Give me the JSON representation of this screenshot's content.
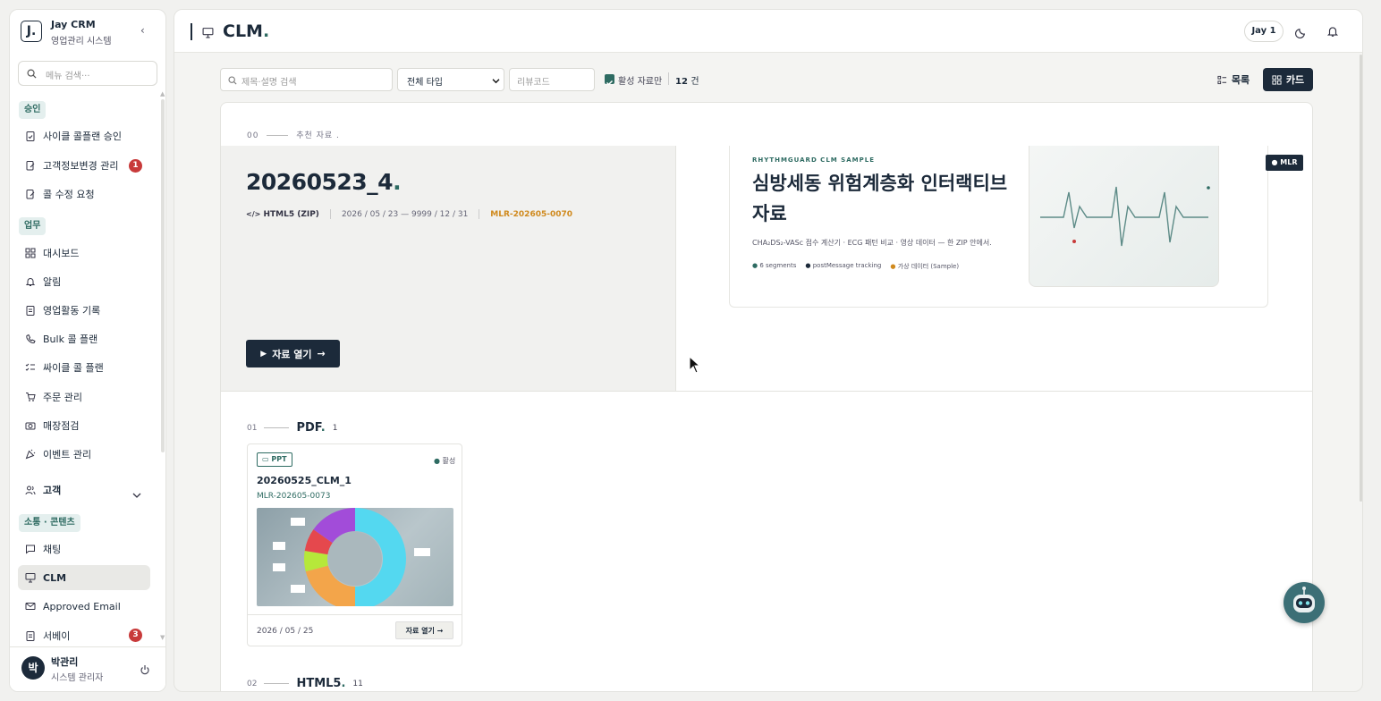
{
  "app": {
    "name": "Jay CRM",
    "subtitle": "영업관리 시스템",
    "logo_glyph": "J.",
    "collapse_glyph": "‹"
  },
  "sidebar": {
    "search_placeholder": "메뉴 검색···",
    "sections": [
      {
        "label": "승인",
        "items": [
          {
            "label": "사이클 콜플랜 승인",
            "icon": "clipboard-check-icon"
          },
          {
            "label": "고객정보변경 관리",
            "icon": "edit-doc-icon",
            "badge": "1"
          },
          {
            "label": "콜 수정 요청",
            "icon": "edit-doc-icon"
          }
        ]
      },
      {
        "label": "업무",
        "items": [
          {
            "label": "대시보드",
            "icon": "grid-icon"
          },
          {
            "label": "알림",
            "icon": "bell-icon"
          },
          {
            "label": "영업활동 기록",
            "icon": "clipboard-icon"
          },
          {
            "label": "Bulk 콜 플랜",
            "icon": "phone-icon"
          },
          {
            "label": "싸이클 콜 플랜",
            "icon": "list-check-icon"
          },
          {
            "label": "주문 관리",
            "icon": "cart-icon"
          },
          {
            "label": "매장점검",
            "icon": "camera-icon"
          },
          {
            "label": "이벤트 관리",
            "icon": "party-icon"
          }
        ]
      },
      {
        "label": "고객",
        "collapsible": true
      },
      {
        "label": "소통 · 콘텐츠",
        "items": [
          {
            "label": "채팅",
            "icon": "chat-icon"
          },
          {
            "label": "CLM",
            "icon": "presentation-icon",
            "active": true
          },
          {
            "label": "Approved Email",
            "icon": "mail-icon"
          },
          {
            "label": "서베이",
            "icon": "clipboard-icon",
            "badge": "3"
          }
        ]
      }
    ],
    "user": {
      "initial": "박",
      "name": "박관리",
      "role": "시스템 관리자"
    }
  },
  "header": {
    "title": "CLM",
    "title_dot": ".",
    "user_chip": "Jay 1"
  },
  "filters": {
    "search_placeholder": "제목·설명 검색",
    "type_selected": "전체 타입",
    "review_placeholder": "리뷰코드",
    "active_only_label": "활성 자료만",
    "active_only_checked": true,
    "count": "12",
    "count_unit": "건",
    "view_list_label": "목록",
    "view_card_label": "카드"
  },
  "featured": {
    "index": "00",
    "section_label": "추천 자료",
    "title": "20260523_4",
    "title_dot": ".",
    "type": "HTML5 (ZIP)",
    "period": "2026 / 05 / 23 — 9999 / 12 / 31",
    "review_code": "MLR-202605-0070",
    "open_label": "자료 열기",
    "preview": {
      "eyebrow": "RHYTHMGUARD CLM SAMPLE",
      "title": "심방세동 위험계층화 인터랙티브 자료",
      "desc": "CHA₂DS₂-VASc 점수 계산기 · ECG 패턴 비교 · 영상 데이터 — 한 ZIP 안에서.",
      "tags": [
        {
          "label": "6 segments",
          "color": "#2e6b62"
        },
        {
          "label": "postMessage tracking",
          "color": "#1c2a3a"
        },
        {
          "label": "가상 데이터 (Sample)",
          "color": "#d08a1e"
        }
      ],
      "badge": "MLR"
    }
  },
  "groups": [
    {
      "index": "01",
      "name": "PDF",
      "dot": ".",
      "count": "1",
      "cards": [
        {
          "type": "PPT",
          "status": "활성",
          "title": "20260525_CLM_1",
          "code": "MLR-202605-0073",
          "date": "2026 / 05 / 25",
          "open_label": "자료 열기"
        }
      ]
    },
    {
      "index": "02",
      "name": "HTML5",
      "dot": ".",
      "count": "11"
    }
  ],
  "colors": {
    "navy": "#1c2a3a",
    "teal": "#2e6b62",
    "amber": "#d08a1e",
    "red": "#c83a3a"
  }
}
